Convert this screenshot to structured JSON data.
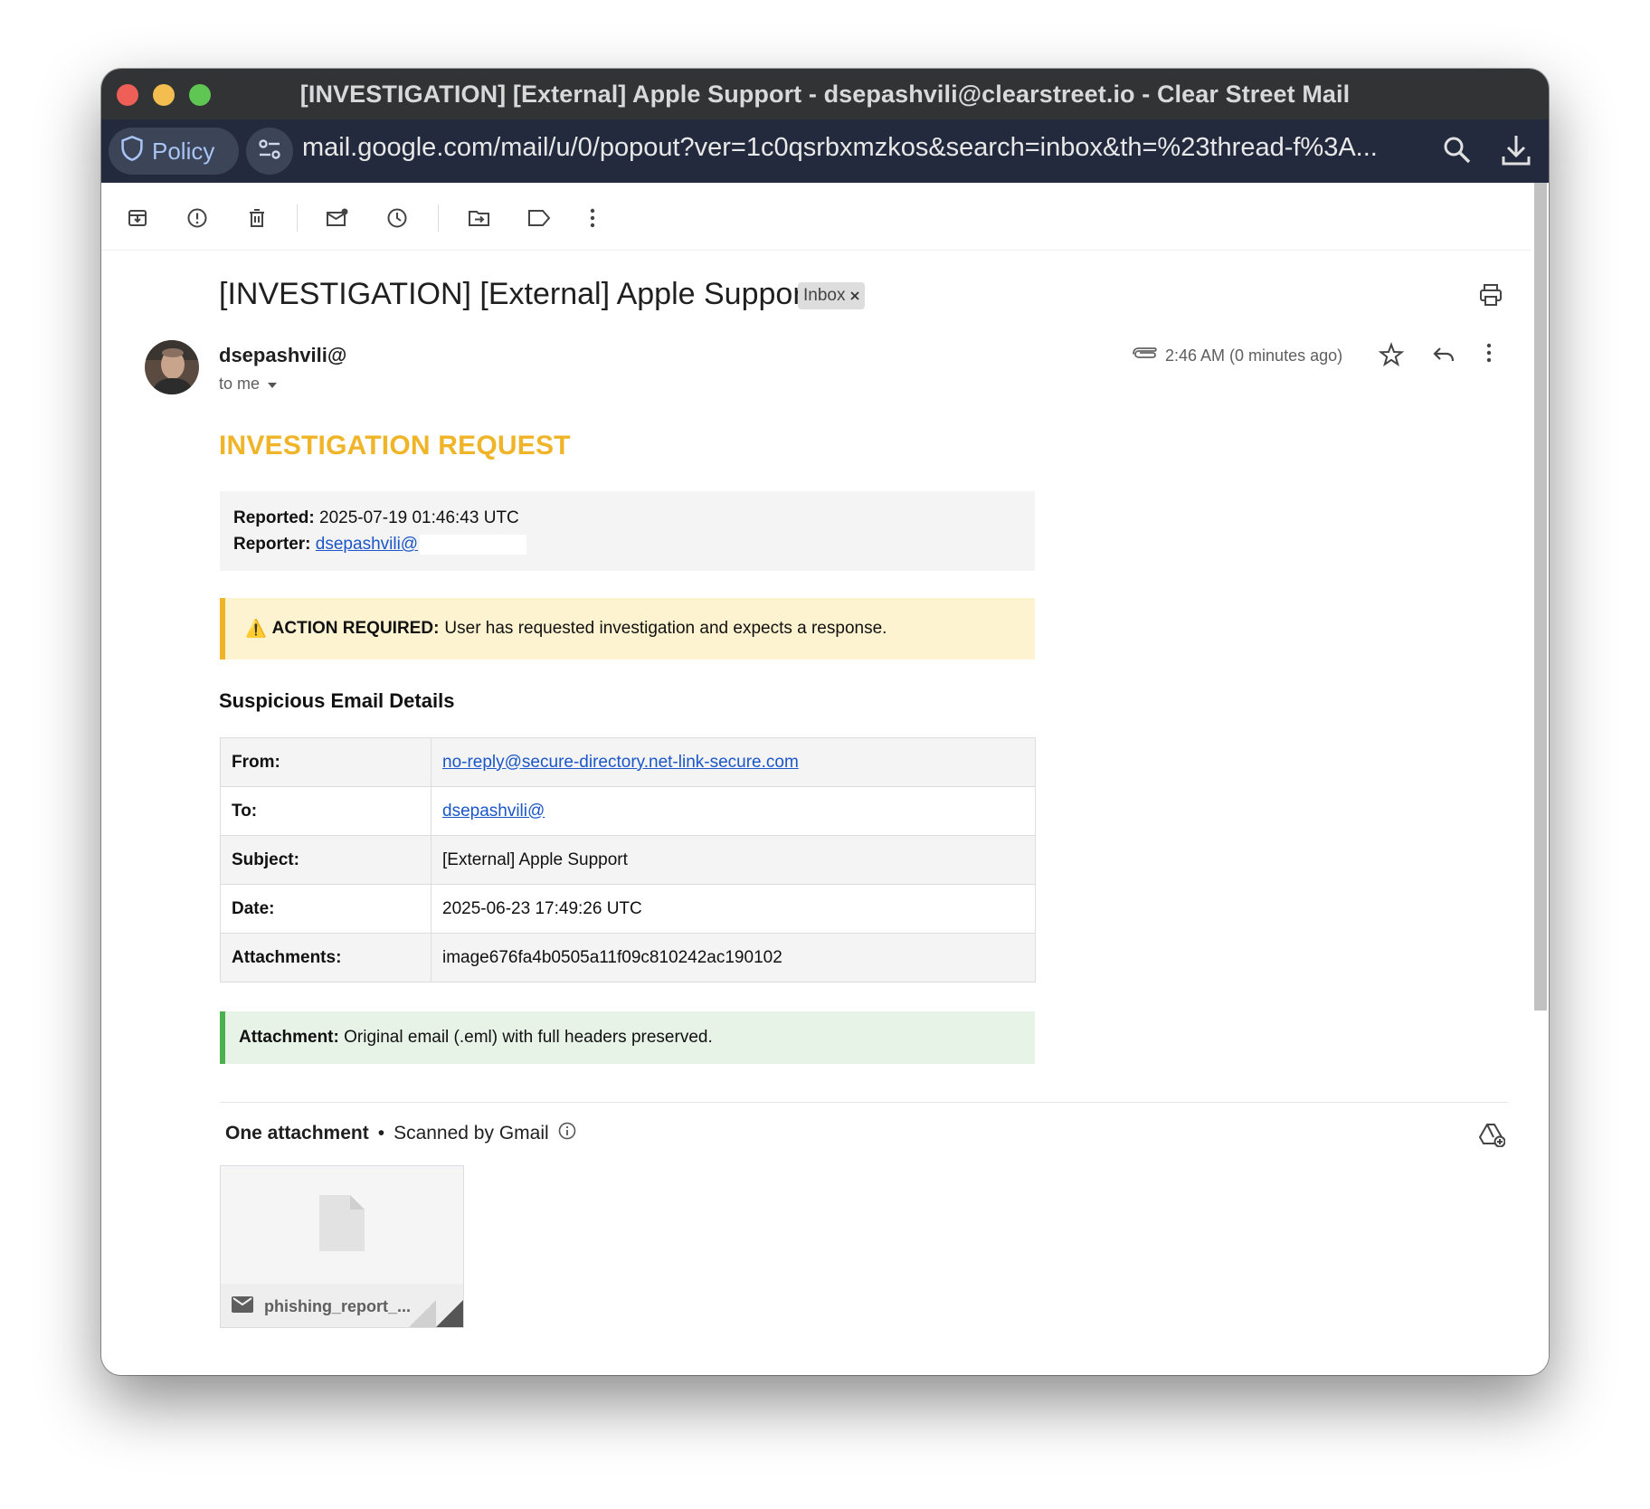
{
  "window": {
    "title": "[INVESTIGATION] [External] Apple Support - dsepashvili@clearstreet.io - Clear Street Mail"
  },
  "urlbar": {
    "policy_label": "Policy",
    "url": "mail.google.com/mail/u/0/popout?ver=1c0qsrbxmzkos&search=inbox&th=%23thread-f%3A..."
  },
  "email": {
    "subject": "[INVESTIGATION] [External] Apple Support",
    "label_chip": "Inbox",
    "sender": "dsepashvili@",
    "recipient_line": "to me",
    "timestamp": "2:46 AM (0 minutes ago)"
  },
  "body": {
    "heading": "INVESTIGATION REQUEST",
    "reported_label": "Reported:",
    "reported_value": "2025-07-19 01:46:43 UTC",
    "reporter_label": "Reporter:",
    "reporter_value": "dsepashvili@",
    "action_icon": "⚠️",
    "action_label": "ACTION REQUIRED:",
    "action_text": "User has requested investigation and expects a response.",
    "details_heading": "Suspicious Email Details",
    "details": [
      {
        "key": "From:",
        "value": "no-reply@secure-directory.net-link-secure.com",
        "link": true
      },
      {
        "key": "To:",
        "value": "dsepashvili@",
        "link": true
      },
      {
        "key": "Subject:",
        "value": "[External] Apple Support",
        "link": false
      },
      {
        "key": "Date:",
        "value": "2025-06-23 17:49:26 UTC",
        "link": false
      },
      {
        "key": "Attachments:",
        "value": "image676fa4b0505a11f09c810242ac190102",
        "link": false
      }
    ],
    "attachment_note_label": "Attachment:",
    "attachment_note_text": "Original email (.eml) with full headers preserved."
  },
  "attachments": {
    "heading": "One attachment",
    "separator": "•",
    "scanned_text": "Scanned by Gmail",
    "file_name": "phishing_report_..."
  },
  "colors": {
    "accent_heading": "#f0b429",
    "link": "#1a56c8",
    "warning_bg": "#fdf3d0",
    "success_bg": "#e8f3e8",
    "success_border": "#4caf50"
  }
}
